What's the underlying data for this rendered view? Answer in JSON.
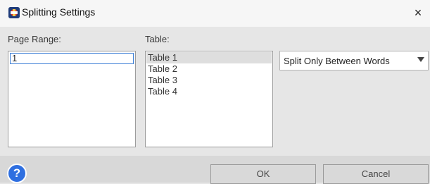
{
  "window": {
    "title": "Splitting Settings",
    "icon": "app-icon",
    "close_glyph": "×"
  },
  "labels": {
    "page_range": "Page Range:",
    "table": "Table:"
  },
  "page_range": {
    "value": "1"
  },
  "tables": {
    "items": [
      "Table 1",
      "Table 2",
      "Table 3",
      "Table 4"
    ],
    "selected_index": 0
  },
  "split_mode": {
    "selected": "Split Only Between Words",
    "icon": "chevron-down-icon"
  },
  "footer": {
    "help_glyph": "?",
    "ok_label": "OK",
    "cancel_label": "Cancel"
  },
  "colors": {
    "accent": "#2f6fe0",
    "input_focus": "#3d7fd6",
    "selected_row": "#dedede"
  }
}
